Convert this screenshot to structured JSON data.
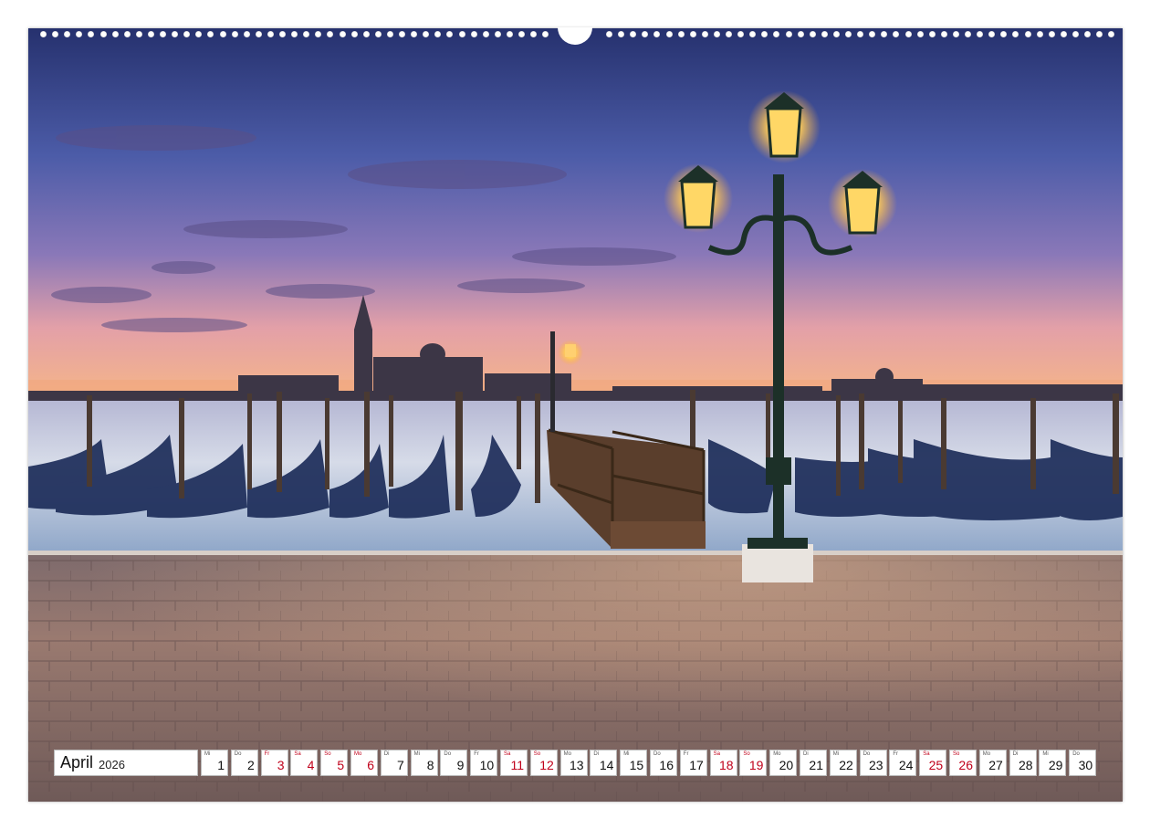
{
  "calendar": {
    "month": "April",
    "year": "2026",
    "days": [
      {
        "wd": "Mi",
        "d": "1",
        "hol": false
      },
      {
        "wd": "Do",
        "d": "2",
        "hol": false
      },
      {
        "wd": "Fr",
        "d": "3",
        "hol": true
      },
      {
        "wd": "Sa",
        "d": "4",
        "hol": true
      },
      {
        "wd": "So",
        "d": "5",
        "hol": true
      },
      {
        "wd": "Mo",
        "d": "6",
        "hol": true
      },
      {
        "wd": "Di",
        "d": "7",
        "hol": false
      },
      {
        "wd": "Mi",
        "d": "8",
        "hol": false
      },
      {
        "wd": "Do",
        "d": "9",
        "hol": false
      },
      {
        "wd": "Fr",
        "d": "10",
        "hol": false
      },
      {
        "wd": "Sa",
        "d": "11",
        "hol": true
      },
      {
        "wd": "So",
        "d": "12",
        "hol": true
      },
      {
        "wd": "Mo",
        "d": "13",
        "hol": false
      },
      {
        "wd": "Di",
        "d": "14",
        "hol": false
      },
      {
        "wd": "Mi",
        "d": "15",
        "hol": false
      },
      {
        "wd": "Do",
        "d": "16",
        "hol": false
      },
      {
        "wd": "Fr",
        "d": "17",
        "hol": false
      },
      {
        "wd": "Sa",
        "d": "18",
        "hol": true
      },
      {
        "wd": "So",
        "d": "19",
        "hol": true
      },
      {
        "wd": "Mo",
        "d": "20",
        "hol": false
      },
      {
        "wd": "Di",
        "d": "21",
        "hol": false
      },
      {
        "wd": "Mi",
        "d": "22",
        "hol": false
      },
      {
        "wd": "Do",
        "d": "23",
        "hol": false
      },
      {
        "wd": "Fr",
        "d": "24",
        "hol": false
      },
      {
        "wd": "Sa",
        "d": "25",
        "hol": true
      },
      {
        "wd": "So",
        "d": "26",
        "hol": true
      },
      {
        "wd": "Mo",
        "d": "27",
        "hol": false
      },
      {
        "wd": "Di",
        "d": "28",
        "hol": false
      },
      {
        "wd": "Mi",
        "d": "29",
        "hol": false
      },
      {
        "wd": "Do",
        "d": "30",
        "hol": false
      }
    ],
    "holiday_color": "#c0001a"
  },
  "photo": {
    "scene_colors": {
      "sky_top": "#2f3f86",
      "sky_horizon": "#f0a07a",
      "water": "#c8d4e6",
      "pavement": "#8a6f66",
      "lamp_glow": "#ffd36a"
    }
  }
}
